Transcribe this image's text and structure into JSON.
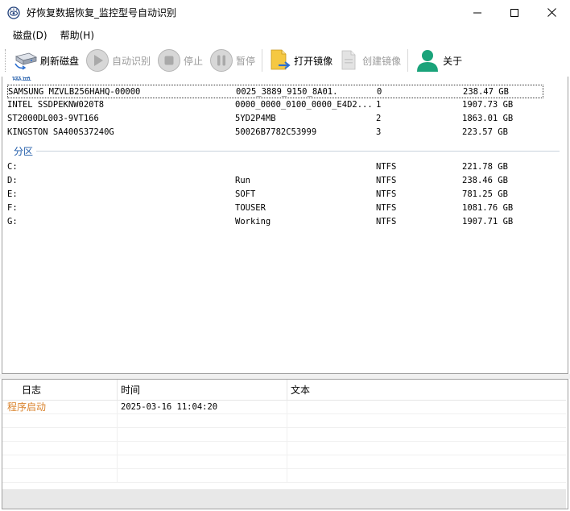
{
  "window": {
    "title": "好恢复数据恢复_监控型号自动识别"
  },
  "menu": {
    "items": [
      {
        "label": "磁盘(D)"
      },
      {
        "label": "帮助(H)"
      }
    ]
  },
  "toolbar": {
    "refresh_label": "刷新磁盘",
    "auto_label": "自动识别",
    "stop_label": "停止",
    "pause_label": "暂停",
    "open_image_label": "打开镜像",
    "create_image_label": "创建镜像",
    "about_label": "关于"
  },
  "disks": {
    "section_label": "磁盘",
    "rows": [
      {
        "model": "SAMSUNG MZVLB256HAHQ-00000",
        "serial": "0025_3889_9150_8A01.",
        "index": "0",
        "size": "238.47 GB"
      },
      {
        "model": "INTEL SSDPEKNW020T8",
        "serial": "0000_0000_0100_0000_E4D2...",
        "index": "1",
        "size": "1907.73 GB"
      },
      {
        "model": "ST2000DL003-9VT166",
        "serial": "5YD2P4MB",
        "index": "2",
        "size": "1863.01 GB"
      },
      {
        "model": "KINGSTON SA400S37240G",
        "serial": "50026B7782C53999",
        "index": "3",
        "size": "223.57 GB"
      }
    ]
  },
  "partitions": {
    "section_label": "分区",
    "rows": [
      {
        "drive": "C:",
        "label": "",
        "fs": "NTFS",
        "size": "221.78 GB"
      },
      {
        "drive": "D:",
        "label": "Run",
        "fs": "NTFS",
        "size": "238.46 GB"
      },
      {
        "drive": "E:",
        "label": "SOFT",
        "fs": "NTFS",
        "size": "781.25 GB"
      },
      {
        "drive": "F:",
        "label": "TOUSER",
        "fs": "NTFS",
        "size": "1081.76 GB"
      },
      {
        "drive": "G:",
        "label": "Working",
        "fs": "NTFS",
        "size": "1907.71 GB"
      }
    ]
  },
  "log": {
    "columns": [
      "日志",
      "时间",
      "文本"
    ],
    "rows": [
      {
        "log": "程序启动",
        "time": "2025-03-16 11:04:20",
        "text": ""
      }
    ]
  },
  "colors": {
    "section_blue": "#1e5aa8",
    "log_entry_orange": "#d9822b"
  }
}
